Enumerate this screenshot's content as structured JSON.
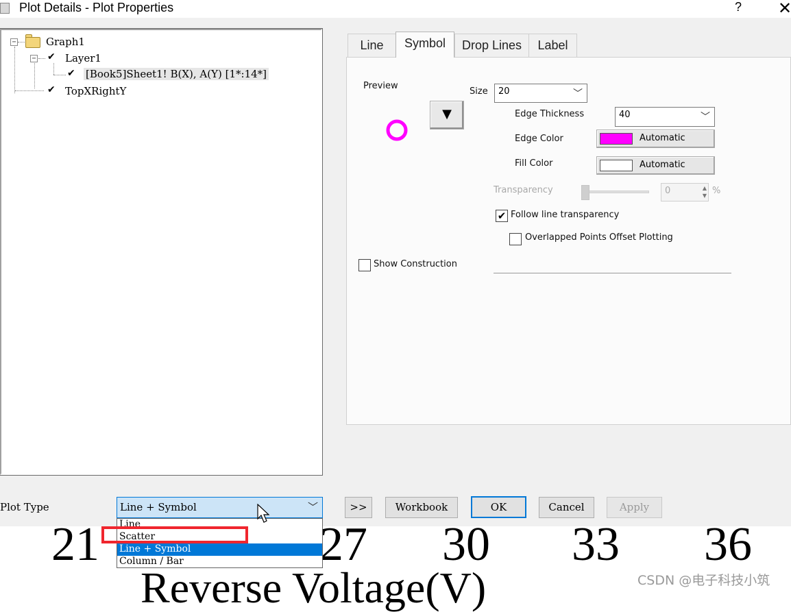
{
  "window": {
    "title": "Plot Details - Plot Properties",
    "help_label": "?",
    "close_label": "✕"
  },
  "tree": {
    "root_label": "Graph1",
    "layer_label": "Layer1",
    "plot_label": "[Book5]Sheet1! B(X), A(Y) [1*:14*]",
    "axis_label": "TopXRightY",
    "expander_symbol": "−"
  },
  "tabs": [
    "Line",
    "Symbol",
    "Drop Lines",
    "Label"
  ],
  "active_tab": "Symbol",
  "symbol_page": {
    "preview_label": "Preview",
    "preview_symbol_color": "#ff00ff",
    "symbol_picker_arrow": "▼",
    "size_label": "Size",
    "size_value": "20",
    "edge_thickness_label": "Edge Thickness",
    "edge_thickness_value": "40",
    "edge_color_label": "Edge Color",
    "edge_color_value": "Automatic",
    "edge_color_swatch": "#ff00ff",
    "fill_color_label": "Fill Color",
    "fill_color_value": "Automatic",
    "fill_color_swatch": "#ffffff",
    "transparency_label": "Transparency",
    "transparency_value": "0",
    "transparency_unit": "%",
    "follow_line_transparency_label": "Follow line transparency",
    "follow_line_transparency_checked": true,
    "overlapped_points_label": "Overlapped Points Offset Plotting",
    "overlapped_points_checked": false,
    "show_construction_label": "Show Construction",
    "show_construction_checked": false
  },
  "bottom": {
    "plot_type_label": "Plot Type",
    "plot_type_value": "Line + Symbol",
    "plot_type_options": [
      "Line",
      "Scatter",
      "Line + Symbol",
      "Column / Bar"
    ],
    "expand_button": ">>",
    "workbook_button": "Workbook",
    "ok_button": "OK",
    "cancel_button": "Cancel",
    "apply_button": "Apply"
  },
  "background": {
    "axis_ticks": [
      "21",
      "27",
      "30",
      "33",
      "36"
    ],
    "axis_title": "Reverse Voltage(V)",
    "watermark": "CSDN @电子科技小筑"
  },
  "highlight_color": "#f0262e"
}
